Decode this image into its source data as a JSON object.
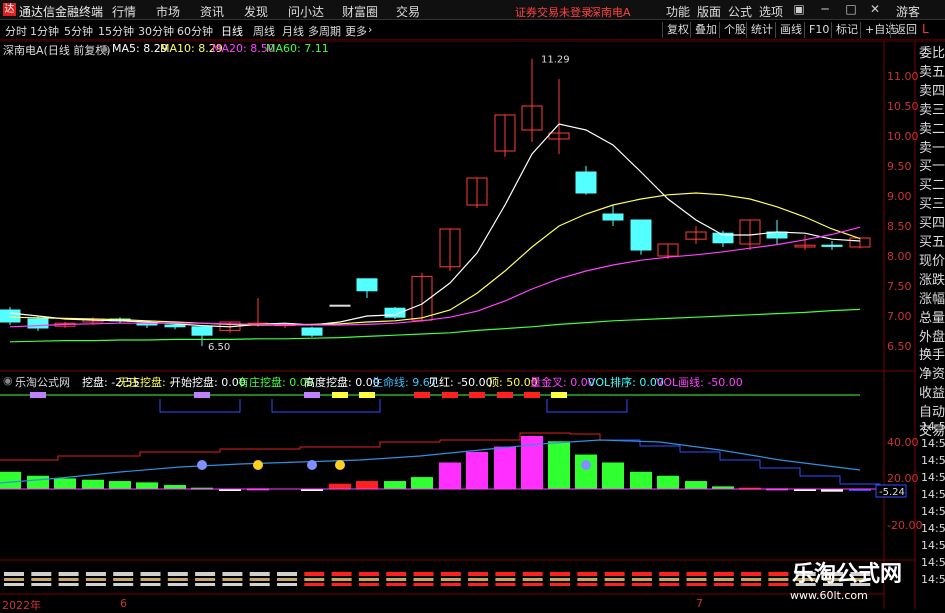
{
  "menubar": {
    "app_title": "通达信金融终端",
    "items": [
      "行情",
      "市场",
      "资讯",
      "发现",
      "问小达",
      "财富圈",
      "交易"
    ],
    "warning": "证券交易未登录",
    "stock": "深南电A",
    "right_items": [
      "功能",
      "版面",
      "公式",
      "选项"
    ],
    "guest": "游客"
  },
  "toolbar": {
    "periods": [
      "分时",
      "1分钟",
      "5分钟",
      "15分钟",
      "30分钟",
      "60分钟",
      "日线",
      "周线",
      "月线",
      "多周期",
      "更多"
    ],
    "active_period": "日线",
    "right_buttons": [
      "复权",
      "叠加",
      "个股",
      "统计",
      "画线",
      "F10",
      "标记",
      "+自选",
      "返回"
    ],
    "l_button": "L"
  },
  "sidebar": [
    "委比",
    "卖五",
    "卖四",
    "卖三",
    "卖二",
    "卖一",
    "买一",
    "买二",
    "买三",
    "买四",
    "买五",
    "现价",
    "涨跌",
    "涨幅",
    "总量",
    "外盘",
    "换手",
    "净资",
    "收益",
    "自动",
    "交易"
  ],
  "main_chart": {
    "title": "深南电A(日线 前复权)",
    "ma": [
      {
        "label": "MA5: 8.29",
        "color": "#ffffff"
      },
      {
        "label": "MA10: 8.29",
        "color": "#ffff60"
      },
      {
        "label": "MA20: 8.50",
        "color": "#ff40ff"
      },
      {
        "label": "MA60: 7.11",
        "color": "#40ff40"
      }
    ],
    "y_ticks": [
      "11.00",
      "10.50",
      "10.00",
      "9.50",
      "9.00",
      "8.50",
      "8.00",
      "7.50",
      "7.00",
      "6.50"
    ],
    "high_label": "11.29",
    "low_label": "6.50"
  },
  "indicator": {
    "title": "乐淘公式网",
    "params": [
      {
        "text": "挖盘: -2.55",
        "color": "#ffffff"
      },
      {
        "text": "无庄挖盘: -",
        "color": "#ffff40"
      },
      {
        "text": "开始挖盘: 0.00",
        "color": "#ffffff"
      },
      {
        "text": "有庄挖盘: 0.00",
        "color": "#40ff40"
      },
      {
        "text": "高度挖盘: 0.00",
        "color": "#ffffff"
      },
      {
        "text": "生命线: 9.67",
        "color": "#40c0ff"
      },
      {
        "text": "见红: -50.00",
        "color": "#ffffff"
      },
      {
        "text": "顶: 50.00",
        "color": "#ffff40"
      },
      {
        "text": "量金叉: 0.00",
        "color": "#ff40ff"
      },
      {
        "text": "VOL排序: 0.00",
        "color": "#40ffff"
      },
      {
        "text": "VOL画线: -50.00",
        "color": "#ff40ff"
      }
    ],
    "y_ticks": [
      "40.00",
      "20.00",
      "-20.00"
    ],
    "current_value": "-5.24",
    "right_labels": [
      "14:56",
      "14:56",
      "14:56",
      "14:56",
      "14:56",
      "14:56",
      "14:56",
      "14:56",
      "14:56",
      "14:56"
    ]
  },
  "xaxis": [
    "2022年",
    "6",
    "7"
  ],
  "watermark": {
    "title": "乐淘公式网",
    "url": "www.60lt.com"
  }
}
